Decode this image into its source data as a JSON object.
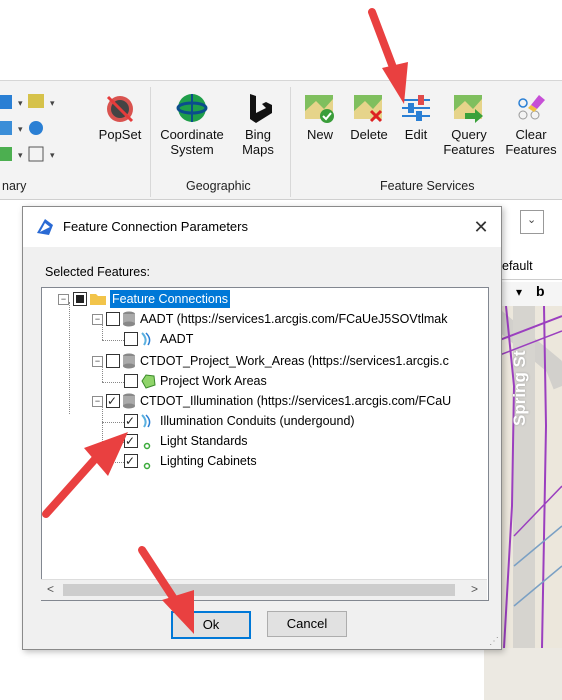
{
  "ribbon": {
    "buttons": {
      "popset": "PopSet",
      "coord_line1": "Coordinate",
      "coord_line2": "System",
      "bing_line1": "Bing",
      "bing_line2": "Maps",
      "new": "New",
      "delete": "Delete",
      "edit": "Edit",
      "query_line1": "Query",
      "query_line2": "Features",
      "clear_line1": "Clear",
      "clear_line2": "Features"
    },
    "groups": {
      "left_partial": "nary",
      "geographic": "Geographic",
      "feature_services": "Feature Services"
    }
  },
  "map": {
    "tab_text": "efault",
    "street_label": "Spring St"
  },
  "dialog": {
    "title": "Feature Connection Parameters",
    "close": "✕",
    "selected_features_label": "Selected Features:",
    "tree": {
      "root": "Feature Connections",
      "aadt_parent": "AADT (https://services1.arcgis.com/FCaUeJ5SOVtlmak",
      "aadt_child": "AADT",
      "ctdot_pwa_parent": "CTDOT_Project_Work_Areas (https://services1.arcgis.c",
      "pwa_child": "Project Work Areas",
      "illum_parent": "CTDOT_Illumination (https://services1.arcgis.com/FCaU",
      "illum_conduits": "Illumination Conduits (undergound)",
      "light_standards": "Light Standards",
      "lighting_cabinets": "Lighting Cabinets"
    },
    "buttons": {
      "ok": "Ok",
      "cancel": "Cancel"
    }
  },
  "colors": {
    "annotation_arrow": "#e94040",
    "selection": "#0078d7",
    "map_line": "#9b3fbf"
  }
}
